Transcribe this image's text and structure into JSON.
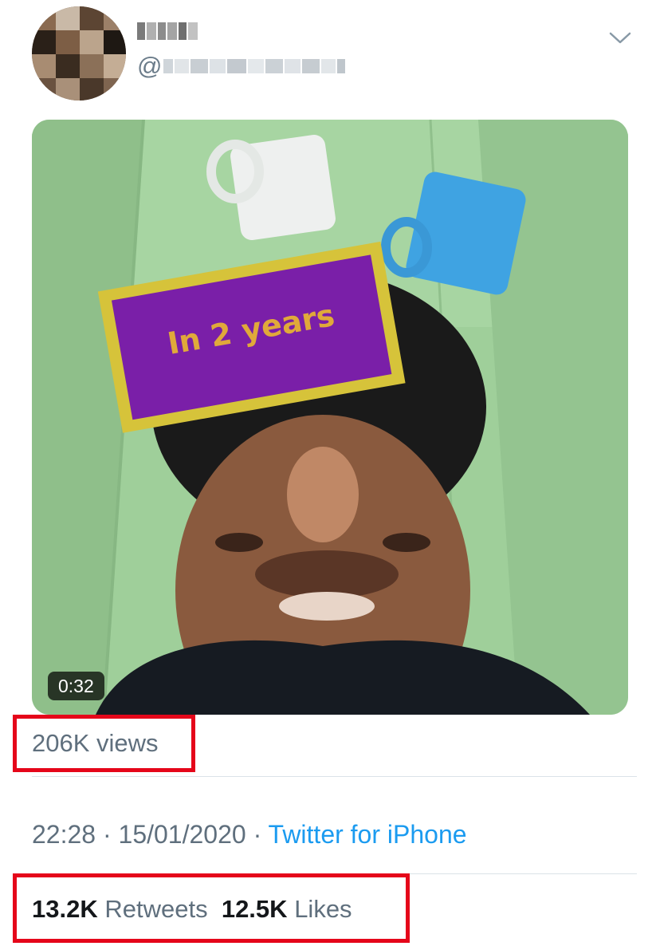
{
  "tweet": {
    "author": {
      "display_name_blurred": true,
      "handle_prefix": "@",
      "handle_blurred": true
    },
    "menu_icon": "chevron-down-icon",
    "media": {
      "type": "video",
      "overlay_text": "In 2 years",
      "duration": "0:32"
    },
    "views": "206K views",
    "time": "22:28",
    "separator": "·",
    "date": "15/01/2020",
    "source": "Twitter for iPhone",
    "stats": {
      "retweets_count": "13.2K",
      "retweets_label": "Retweets",
      "likes_count": "12.5K",
      "likes_label": "Likes"
    }
  },
  "colors": {
    "highlight": "#e5061a",
    "link": "#1b9bf0",
    "muted": "#5f6f7d",
    "text": "#14171a"
  }
}
